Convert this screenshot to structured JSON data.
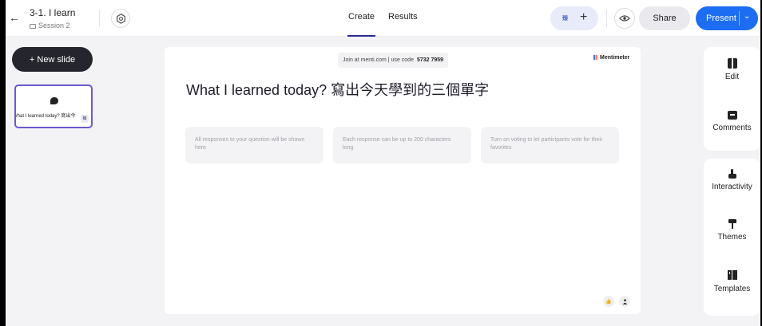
{
  "header": {
    "back_icon": "arrow-left-icon",
    "presentation_title": "3-1. I learn",
    "folder_name": "Session 2",
    "settings_icon": "settings-icon",
    "tabs": [
      {
        "label": "Create",
        "active": true
      },
      {
        "label": "Results",
        "active": false
      }
    ],
    "collaborator_badge": "臻",
    "add_collaborator_icon": "plus-icon",
    "preview_icon": "eye-icon",
    "share_label": "Share",
    "present_label": "Present",
    "present_accent": "#1c6df2"
  },
  "sidebar": {
    "new_slide_label": "+ New slide",
    "thumbnail": {
      "title": "What I learned today? 寫出今",
      "badge": "臻",
      "selected_border": "#6a5acd"
    }
  },
  "slide": {
    "join_text": "Join at menti.com | use code",
    "join_code": "5732 7959",
    "brand": "Mentimeter",
    "question": "What I learned today? 寫出今天學到的三個單字",
    "cards": [
      "All responses to your question will be shown here",
      "Each response can be up to 200 characters long",
      "Turn on voting to let participants vote for their favorites"
    ],
    "reactions": [
      "thumbs-up-icon",
      "person-icon"
    ]
  },
  "right_panel": {
    "items": [
      {
        "label": "Edit",
        "icon": "edit-panel-icon"
      },
      {
        "label": "Comments",
        "icon": "comment-icon"
      },
      {
        "label": "Interactivity",
        "icon": "pointer-hand-icon"
      },
      {
        "label": "Themes",
        "icon": "paint-roller-icon"
      },
      {
        "label": "Templates",
        "icon": "templates-icon"
      }
    ]
  }
}
